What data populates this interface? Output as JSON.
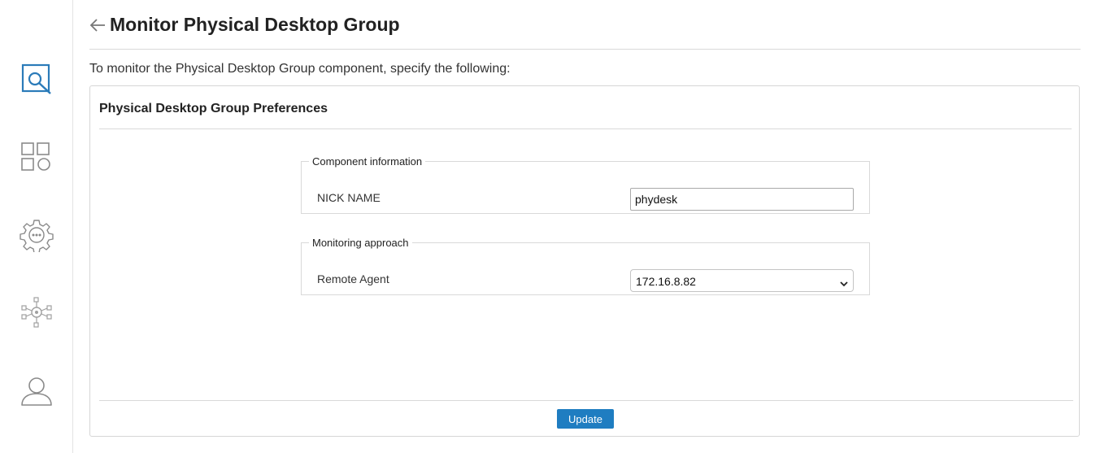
{
  "sidebar": {
    "items": [
      {
        "icon": "monitor-search-icon"
      },
      {
        "icon": "components-grid-icon"
      },
      {
        "icon": "settings-gear-icon"
      },
      {
        "icon": "network-config-icon"
      },
      {
        "icon": "user-profile-icon"
      }
    ]
  },
  "header": {
    "back_icon": "back-arrow-icon",
    "title": "Monitor Physical Desktop Group"
  },
  "intro_text": "To monitor the Physical Desktop Group component, specify the following:",
  "panel": {
    "title": "Physical Desktop Group Preferences",
    "component_info": {
      "legend": "Component information",
      "nick_name_label": "NICK NAME",
      "nick_name_value": "phydesk"
    },
    "monitoring_approach": {
      "legend": "Monitoring approach",
      "remote_agent_label": "Remote Agent",
      "remote_agent_value": "172.16.8.82"
    },
    "update_label": "Update"
  },
  "colors": {
    "accent": "#1f7dc1",
    "active_icon": "#2b7bb9",
    "inactive_icon": "#8a8a8a"
  }
}
